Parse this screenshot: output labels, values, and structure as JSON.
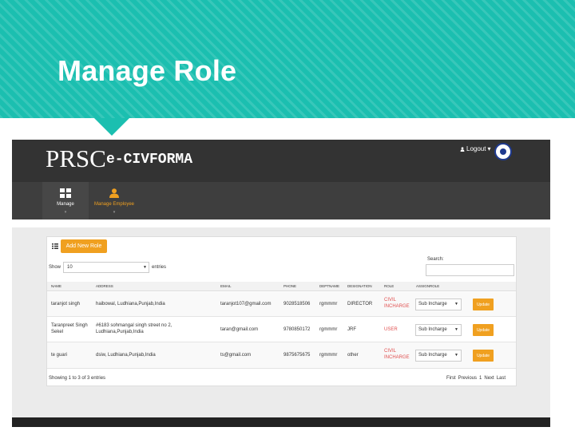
{
  "slide": {
    "title": "Manage Role"
  },
  "app": {
    "logo": "PRSC",
    "logo_sub": "e-CIVFORMA",
    "logout_label": "Logout"
  },
  "nav": {
    "items": [
      {
        "label": "Manage",
        "icon": "grid-icon"
      },
      {
        "label": "Manage Employee",
        "icon": "user-icon"
      }
    ]
  },
  "panel": {
    "add_button": "Add New Role",
    "show_label": "Show",
    "entries_value": "10",
    "entries_label": "entries",
    "search_label": "Search:",
    "search_value": ""
  },
  "table": {
    "columns": [
      "NAME",
      "ADDRESS",
      "EMAIL",
      "PHONE",
      "DEPTNAME",
      "DESIGNATION",
      "ROLE",
      "ASSIGNROLE"
    ],
    "rows": [
      {
        "name": "taranjot singh",
        "address": "haibowal, Ludhiana,Punjab,India",
        "email": "taranjot107@gmail.com",
        "phone": "9028518506",
        "dept": "rgmmmr",
        "designation": "DIRECTOR",
        "role": "CIVIL INCHARGE",
        "assign": "Sub Incharge",
        "update": "Update"
      },
      {
        "name": "Taranpreet Singh Sekel",
        "address": "#6183 sohmangal singh street no 2, Ludhiana,Punjab,India",
        "email": "taran@gmail.com",
        "phone": "9780850172",
        "dept": "rgmmmr",
        "designation": "JRF",
        "role": "USER",
        "assign": "Sub Incharge",
        "update": "Update"
      },
      {
        "name": "te guari",
        "address": "dsiw, Ludhiana,Punjab,India",
        "email": "ts@gmail.com",
        "phone": "9875675675",
        "dept": "rgmmmr",
        "designation": "other",
        "role": "CIVIL INCHARGE",
        "assign": "Sub Incharge",
        "update": "Update"
      }
    ]
  },
  "footer": {
    "showing": "Showing 1 to 3 of 3 entries",
    "first": "First",
    "previous": "Previous",
    "page": "1",
    "next": "Next",
    "last": "Last"
  },
  "colors": {
    "banner": "#1bbfb0",
    "accent": "#f0a020",
    "topbar": "#333333",
    "role_text": "#e05050"
  }
}
